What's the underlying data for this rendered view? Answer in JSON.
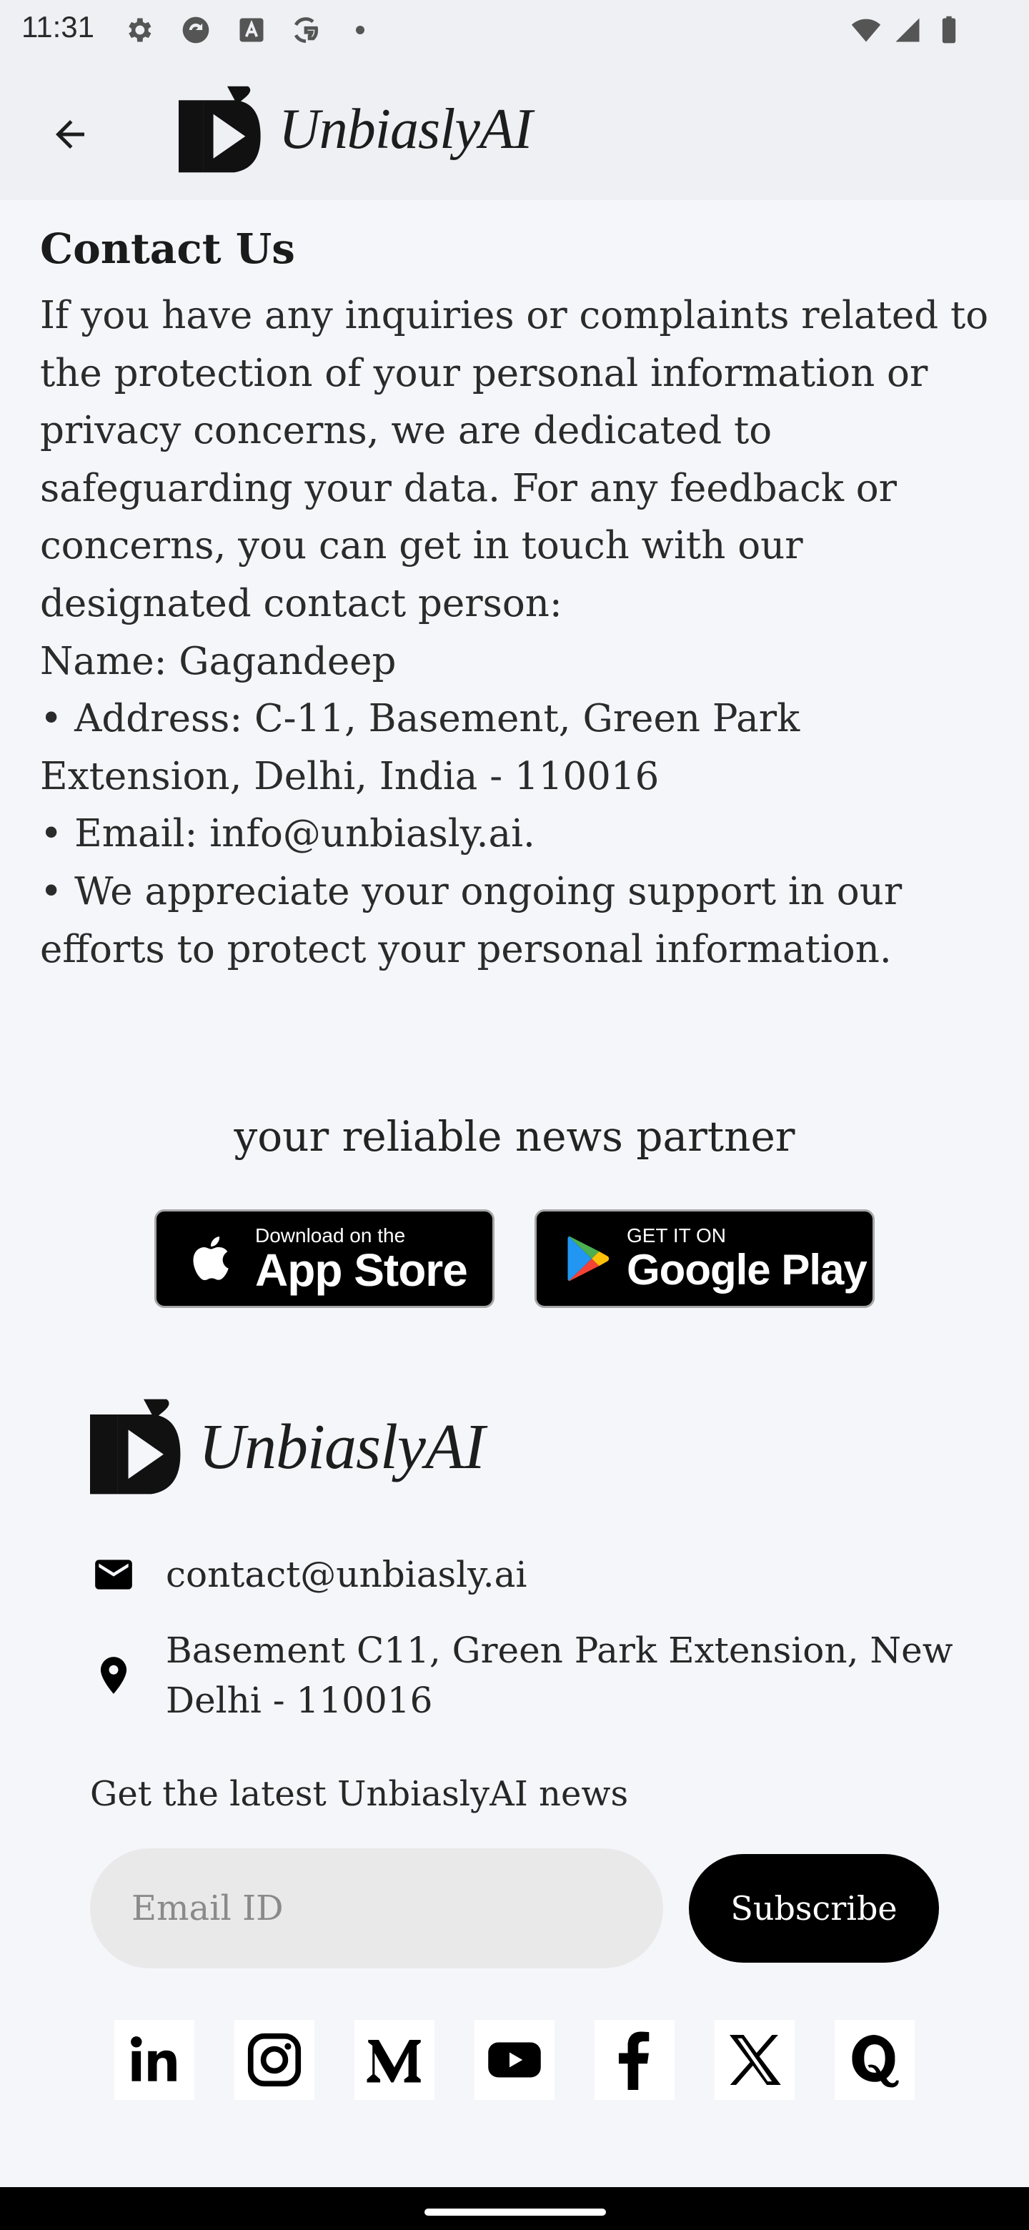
{
  "status_bar": {
    "time": "11:31",
    "icons": [
      "settings-icon",
      "sync-icon",
      "font-icon",
      "google-icon",
      "dot-icon",
      "wifi-icon",
      "signal-icon",
      "battery-icon"
    ]
  },
  "app_bar": {
    "back_icon": "arrow-back-icon",
    "logo_text": "UnbiaslyAI"
  },
  "page": {
    "title": "Contact Us",
    "paragraphs": [
      "If you have any inquiries or complaints related to the protection of your personal information or privacy concerns, we are dedicated to safeguarding your data. For any feedback or concerns, you can get in touch with our designated contact person:",
      "Name: Gagandeep",
      "• Address: C-11, Basement, Green Park Extension, Delhi, India - 110016",
      "• Email: info@unbiasly.ai.",
      "• We appreciate your ongoing support in our efforts to protect your personal information."
    ]
  },
  "footer": {
    "tagline": "your reliable news partner",
    "app_store": {
      "small": "Download on the",
      "big": "App Store"
    },
    "google_play": {
      "small": "GET IT ON",
      "big": "Google Play"
    },
    "logo_text": "UnbiaslyAI",
    "contact_email": "contact@unbiasly.ai",
    "address_line1": "Basement C11, Green Park Extension, New",
    "address_line2": "Delhi - 110016",
    "news_label": "Get the latest UnbiaslyAI news",
    "email_placeholder": "Email ID",
    "subscribe_label": "Subscribe",
    "social": [
      "linkedin-icon",
      "instagram-icon",
      "medium-icon",
      "youtube-icon",
      "facebook-icon",
      "x-icon",
      "quora-icon"
    ]
  },
  "colors": {
    "header_bg": "#eff0f4",
    "page_bg": "#f5f6fa",
    "button_bg": "#000000",
    "input_bg": "#e9e9e9"
  }
}
